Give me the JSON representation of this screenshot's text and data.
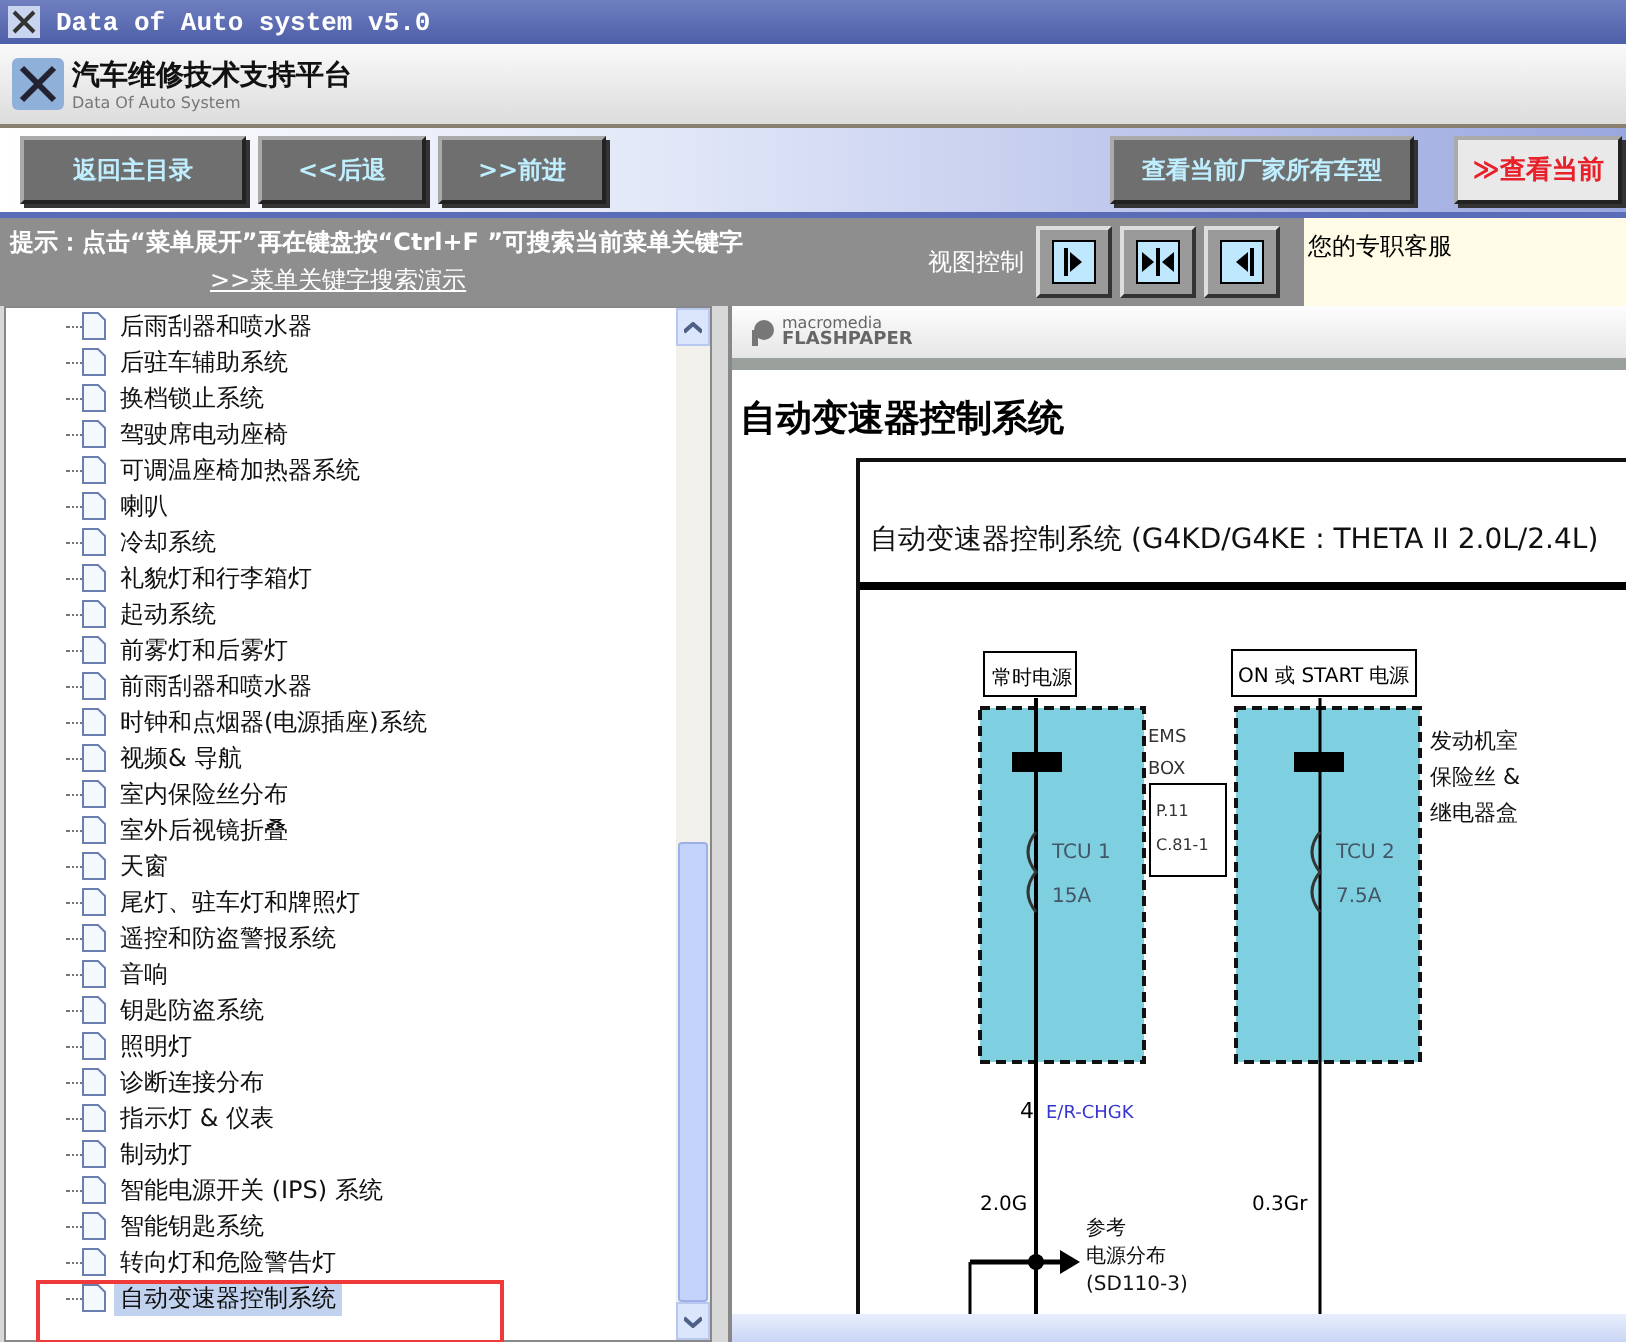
{
  "window": {
    "title": "Data of Auto system v5.0"
  },
  "header": {
    "title": "汽车维修技术支持平台",
    "subtitle": "Data Of Auto System"
  },
  "toolbar": {
    "nav_buttons": [
      {
        "label": "返回主目录"
      },
      {
        "label": "<<后退"
      },
      {
        "label": ">>前进"
      }
    ],
    "right_buttons": [
      {
        "label": "查看当前厂家所有车型",
        "kind": "plain"
      },
      {
        "label": "≫查看当前",
        "kind": "highlight"
      }
    ]
  },
  "hint": {
    "text": "提示：点击“菜单展开”再在键盘按“Ctrl+F ”可搜索当前菜单关键字",
    "link": ">>菜单关键字搜索演示"
  },
  "view_control": {
    "label": "视图控制",
    "buttons": [
      {
        "kind": "right"
      },
      {
        "kind": "both"
      },
      {
        "kind": "left"
      }
    ]
  },
  "service": {
    "label": "您的专职客服"
  },
  "tree": {
    "items": [
      {
        "label": "后雨刮器和喷水器",
        "selected": false
      },
      {
        "label": "后驻车辅助系统",
        "selected": false
      },
      {
        "label": "换档锁止系统",
        "selected": false
      },
      {
        "label": "驾驶席电动座椅",
        "selected": false
      },
      {
        "label": "可调温座椅加热器系统",
        "selected": false
      },
      {
        "label": "喇叭",
        "selected": false
      },
      {
        "label": "冷却系统",
        "selected": false
      },
      {
        "label": "礼貌灯和行李箱灯",
        "selected": false
      },
      {
        "label": "起动系统",
        "selected": false
      },
      {
        "label": "前雾灯和后雾灯",
        "selected": false
      },
      {
        "label": "前雨刮器和喷水器",
        "selected": false
      },
      {
        "label": "时钟和点烟器(电源插座)系统",
        "selected": false
      },
      {
        "label": "视频& 导航",
        "selected": false
      },
      {
        "label": "室内保险丝分布",
        "selected": false
      },
      {
        "label": "室外后视镜折叠",
        "selected": false
      },
      {
        "label": "天窗",
        "selected": false
      },
      {
        "label": "尾灯、驻车灯和牌照灯",
        "selected": false
      },
      {
        "label": "遥控和防盗警报系统",
        "selected": false
      },
      {
        "label": "音响",
        "selected": false
      },
      {
        "label": "钥匙防盗系统",
        "selected": false
      },
      {
        "label": "照明灯",
        "selected": false
      },
      {
        "label": "诊断连接分布",
        "selected": false
      },
      {
        "label": "指示灯 & 仪表",
        "selected": false
      },
      {
        "label": "制动灯",
        "selected": false
      },
      {
        "label": "智能电源开关 (IPS) 系统",
        "selected": false
      },
      {
        "label": "智能钥匙系统",
        "selected": false
      },
      {
        "label": "转向灯和危险警告灯",
        "selected": false
      },
      {
        "label": "自动变速器控制系统",
        "selected": true
      }
    ]
  },
  "viewer": {
    "brand_top": "macromedia",
    "brand_bottom": "FLASHPAPER",
    "heading": "自动变速器控制系统",
    "diagram": {
      "title": "自动变速器控制系统 (G4KD/G4KE : THETA II 2.0L/2.4L)",
      "supply_1": "常时电源",
      "supply_2": "ON 或 START 电源",
      "box_1_label": [
        "EMS",
        "BOX"
      ],
      "ref_box": [
        "P.11",
        "C.81-1"
      ],
      "box_2_label": [
        "发动机室",
        "保险丝 &",
        "继电器盒"
      ],
      "fuse_1": [
        "TCU 1",
        "15A"
      ],
      "fuse_2": [
        "TCU 2",
        "7.5A"
      ],
      "pin": "4",
      "connector": "E/R-CHGK",
      "wire_1": "2.0G",
      "wire_2": "0.3Gr",
      "reference": [
        "参考",
        "电源分布",
        "(SD110-3)"
      ]
    }
  }
}
